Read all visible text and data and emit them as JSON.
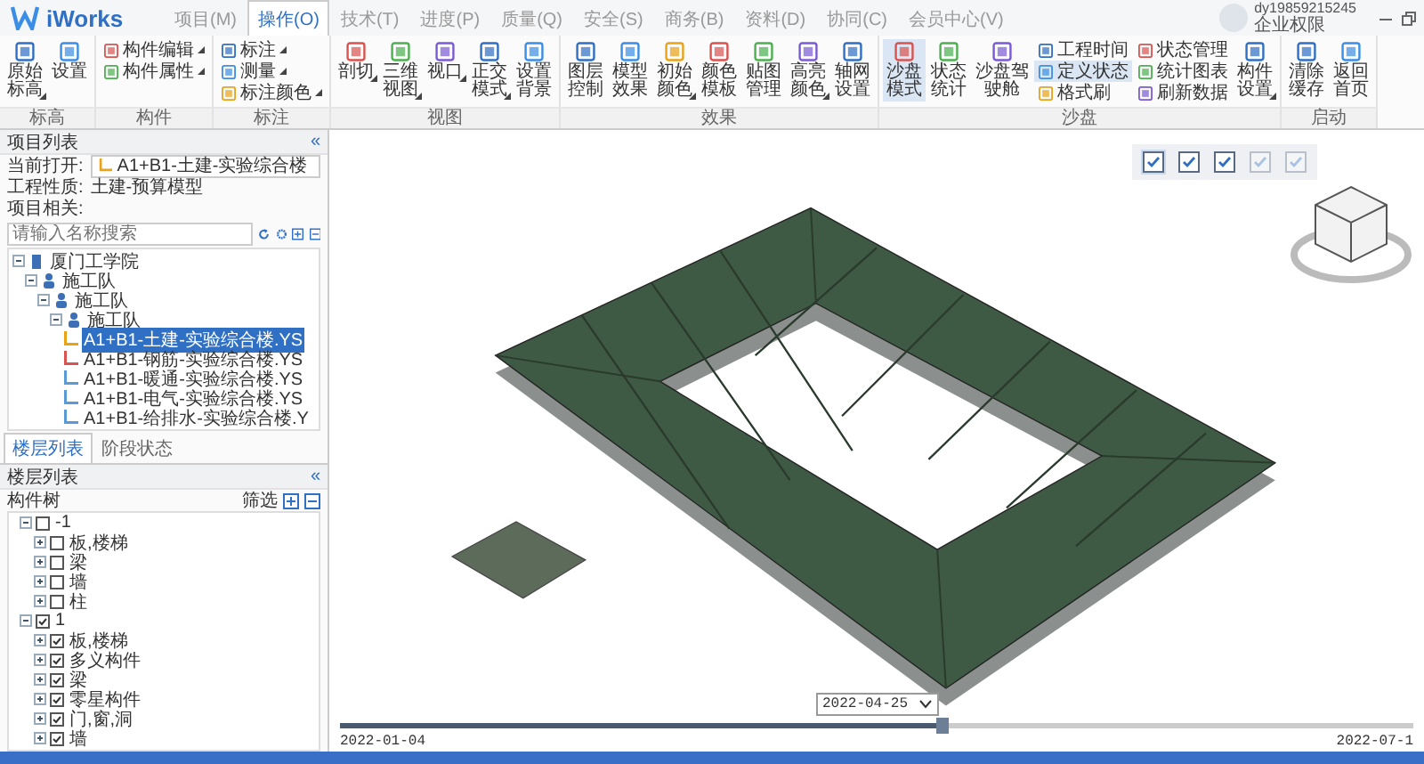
{
  "app": {
    "name": "iWorks"
  },
  "menu_tabs": [
    {
      "label": "项目(M)",
      "selected": false
    },
    {
      "label": "操作(O)",
      "selected": true
    },
    {
      "label": "技术(T)",
      "selected": false
    },
    {
      "label": "进度(P)",
      "selected": false
    },
    {
      "label": "质量(Q)",
      "selected": false
    },
    {
      "label": "安全(S)",
      "selected": false
    },
    {
      "label": "商务(B)",
      "selected": false
    },
    {
      "label": "资料(D)",
      "selected": false
    },
    {
      "label": "协同(C)",
      "selected": false
    },
    {
      "label": "会员中心(V)",
      "selected": false
    }
  ],
  "user": {
    "name": "dy19859215245",
    "role": "企业权限"
  },
  "ribbon": [
    {
      "label": "标高",
      "items": [
        {
          "label": "原始标高",
          "kind": "large",
          "dropdown": true,
          "selected": false
        },
        {
          "label": "设置",
          "kind": "large",
          "dropdown": false,
          "selected": false
        }
      ]
    },
    {
      "label": "构件",
      "items": [
        {
          "label": "构件编辑",
          "kind": "small",
          "dropdown": true,
          "selected": false
        },
        {
          "label": "构件属性",
          "kind": "small",
          "dropdown": true,
          "selected": false
        }
      ]
    },
    {
      "label": "标注",
      "items": [
        {
          "label": "标注",
          "kind": "small",
          "dropdown": true,
          "selected": false
        },
        {
          "label": "测量",
          "kind": "small",
          "dropdown": true,
          "selected": false
        },
        {
          "label": "标注颜色",
          "kind": "small",
          "dropdown": true,
          "selected": false
        }
      ]
    },
    {
      "label": "视图",
      "items": [
        {
          "label": "剖切",
          "kind": "large",
          "dropdown": true,
          "selected": false
        },
        {
          "label": "三维视图",
          "kind": "large",
          "dropdown": true,
          "selected": false
        },
        {
          "label": "视口",
          "kind": "large",
          "dropdown": true,
          "selected": false
        },
        {
          "label": "正交模式",
          "kind": "large",
          "dropdown": true,
          "selected": false
        },
        {
          "label": "设置背景",
          "kind": "large",
          "dropdown": false,
          "selected": false
        }
      ]
    },
    {
      "label": "效果",
      "items": [
        {
          "label": "图层控制",
          "kind": "large",
          "dropdown": false,
          "selected": false
        },
        {
          "label": "模型效果",
          "kind": "large",
          "dropdown": false,
          "selected": false
        },
        {
          "label": "初始颜色",
          "kind": "large",
          "dropdown": true,
          "selected": false
        },
        {
          "label": "颜色模板",
          "kind": "large",
          "dropdown": false,
          "selected": false
        },
        {
          "label": "贴图管理",
          "kind": "large",
          "dropdown": false,
          "selected": false
        },
        {
          "label": "高亮颜色",
          "kind": "large",
          "dropdown": true,
          "selected": false
        },
        {
          "label": "轴网设置",
          "kind": "large",
          "dropdown": false,
          "selected": false
        }
      ]
    },
    {
      "label": "沙盘",
      "items": [
        {
          "label": "沙盘模式",
          "kind": "large",
          "dropdown": false,
          "selected": true
        },
        {
          "label": "状态统计",
          "kind": "large",
          "dropdown": false,
          "selected": false
        },
        {
          "label": "沙盘驾驶舱",
          "kind": "large",
          "dropdown": false,
          "selected": false
        },
        {
          "label": "工程时间",
          "kind": "small",
          "dropdown": false,
          "selected": false
        },
        {
          "label": "定义状态",
          "kind": "small",
          "dropdown": false,
          "selected": true
        },
        {
          "label": "格式刷",
          "kind": "small",
          "dropdown": false,
          "selected": false
        },
        {
          "label": "状态管理",
          "kind": "small",
          "dropdown": false,
          "selected": false
        },
        {
          "label": "统计图表",
          "kind": "small",
          "dropdown": false,
          "selected": false
        },
        {
          "label": "刷新数据",
          "kind": "small",
          "dropdown": false,
          "selected": false
        },
        {
          "label": "构件设置",
          "kind": "large",
          "dropdown": true,
          "selected": false
        }
      ]
    },
    {
      "label": "启动",
      "items": [
        {
          "label": "清除缓存",
          "kind": "large",
          "dropdown": false,
          "selected": false
        },
        {
          "label": "返回首页",
          "kind": "large",
          "dropdown": false,
          "selected": false
        }
      ]
    }
  ],
  "project_panel": {
    "title": "项目列表",
    "collapse": "«",
    "current_label": "当前打开:",
    "current_value": "A1+B1-土建-实验综合楼",
    "nature_label": "工程性质:",
    "nature_value": "土建-预算模型",
    "related_label": "项目相关:",
    "search_placeholder": "请输入名称搜索",
    "tree": [
      {
        "label": "厦门工学院",
        "kind": "org",
        "expanded": true,
        "selected": false,
        "children": [
          {
            "label": "施工队",
            "kind": "team",
            "expanded": true,
            "selected": false,
            "children": [
              {
                "label": "施工队",
                "kind": "team",
                "expanded": true,
                "selected": false,
                "children": [
                  {
                    "label": "施工队",
                    "kind": "team",
                    "expanded": true,
                    "selected": false,
                    "children": [
                      {
                        "label": "A1+B1-土建-实验综合楼.YS",
                        "kind": "file",
                        "selected": true,
                        "color": "#e8a317"
                      },
                      {
                        "label": "A1+B1-钢筋-实验综合楼.YS",
                        "kind": "file",
                        "selected": false,
                        "color": "#d9534f"
                      },
                      {
                        "label": "A1+B1-暖通-实验综合楼.YS",
                        "kind": "file",
                        "selected": false,
                        "color": "#5b9bd5"
                      },
                      {
                        "label": "A1+B1-电气-实验综合楼.YS",
                        "kind": "file",
                        "selected": false,
                        "color": "#5b9bd5"
                      },
                      {
                        "label": "A1+B1-给排水-实验综合楼.Y",
                        "kind": "file",
                        "selected": false,
                        "color": "#5b9bd5"
                      }
                    ]
                  }
                ]
              }
            ]
          }
        ]
      }
    ]
  },
  "panel_tabs": [
    {
      "label": "楼层列表",
      "selected": true
    },
    {
      "label": "阶段状态",
      "selected": false
    }
  ],
  "floor_panel": {
    "title": "楼层列表",
    "collapse": "«",
    "tree_label": "构件树",
    "filter": "筛选",
    "floors": [
      {
        "label": "-1",
        "checked": false,
        "expanded": true,
        "children": [
          {
            "label": "板,楼梯",
            "checked": false
          },
          {
            "label": "梁",
            "checked": false
          },
          {
            "label": "墙",
            "checked": false
          },
          {
            "label": "柱",
            "checked": false
          }
        ]
      },
      {
        "label": "1",
        "checked": true,
        "expanded": true,
        "children": [
          {
            "label": "板,楼梯",
            "checked": true
          },
          {
            "label": "多义构件",
            "checked": true
          },
          {
            "label": "梁",
            "checked": true
          },
          {
            "label": "零星构件",
            "checked": true
          },
          {
            "label": "门,窗,洞",
            "checked": true
          },
          {
            "label": "墙",
            "checked": true
          }
        ]
      }
    ]
  },
  "viewport_toolbar": [
    {
      "selected": true,
      "disabled": false
    },
    {
      "selected": false,
      "disabled": false
    },
    {
      "selected": false,
      "disabled": false
    },
    {
      "selected": false,
      "disabled": true
    },
    {
      "selected": false,
      "disabled": true
    }
  ],
  "timeline": {
    "start": "2022-01-04",
    "end": "2022-07-1",
    "current": "2022-04-25",
    "level": 0.56
  }
}
